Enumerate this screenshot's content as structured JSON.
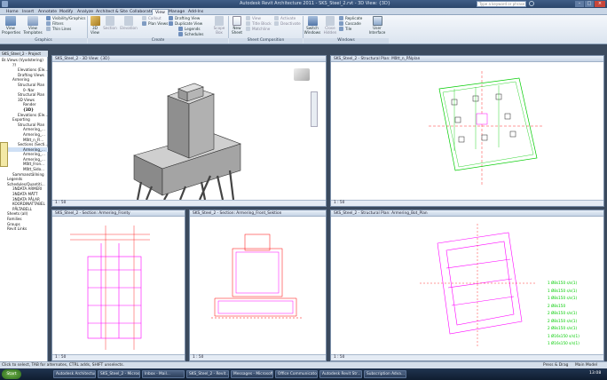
{
  "window": {
    "title": "Autodesk Revit Architecture 2011 - SKS_Steel_2.rvt - 3D View: {3D}"
  },
  "ribbon_tabs": [
    "Home",
    "Insert",
    "Annotate",
    "Modify",
    "Analyze",
    "Architect & Site",
    "Collaborate",
    "View",
    "Manage",
    "Add-Ins"
  ],
  "active_tab": "View",
  "ribbon": {
    "graphics": {
      "label": "Graphics",
      "view_properties": "View Properties",
      "view_templates": "View Templates",
      "visibility_graphics": "Visibility/Graphics",
      "filters": "Filters",
      "thin_lines": "Thin Lines"
    },
    "create": {
      "label": "Create",
      "view_3d": "3D View",
      "section": "Section",
      "elevation": "Elevation",
      "callout": "Callout",
      "plan_views": "Plan Views",
      "drafting_view": "Drafting View",
      "duplicate_view": "Duplicate View",
      "legends": "Legends",
      "schedules": "Schedules",
      "scope_box": "Scope Box"
    },
    "sheet_composition": {
      "label": "Sheet Composition",
      "new_sheet": "New Sheet",
      "view": "View",
      "title_block": "Title Block",
      "matchline": "Matchline",
      "activate": "Activate",
      "deactivate": "Deactivate"
    },
    "windows": {
      "label": "Windows",
      "switch_windows": "Switch Windows",
      "close_hidden": "Close Hidden",
      "replicate": "Replicate",
      "cascade": "Cascade",
      "tile": "Tile",
      "user_interface": "User Interface"
    }
  },
  "search": {
    "placeholder": "Type a keyword or phrase"
  },
  "browser": {
    "title": "SKS_Steel_2 - Project Br...",
    "items": [
      "Views (Vyodstering)",
      "??",
      "Elevations (Ele...",
      "Drafting Views",
      "Armering",
      "Structural Plan",
      "0- Nar",
      "Structural Plan",
      "3D Views",
      "Render",
      "{3D}",
      "Elevations (Ele...",
      "Exporting",
      "Structural Plan",
      "Armering_...",
      "Armering_...",
      "Mått_n_Fl...",
      "Sections (Secti...",
      "Armering_...",
      "Armering_...",
      "Armering_...",
      "Mått_Fron...",
      "Mått_Sido...",
      "Sammanställning",
      "Legends",
      "Schedules/Quantiti...",
      "3NDATA ARMERI",
      "3NDATA MÄTT",
      "3NDATA PÅLAR",
      "KOORDINATTABEL",
      "PÅLTABELL",
      "Sheets (all)",
      "Families",
      "Groups",
      "Revit Links"
    ]
  },
  "views": [
    {
      "title": "SKS_Steel_2 - 3D View: {3D}",
      "scale": "1 : 50"
    },
    {
      "title": "SKS_Steel_2 - Structural Plan: Mått_n_Pålplan",
      "scale": "1 : 50"
    },
    {
      "title": "SKS_Steel_2 - Section: Armering_Fronty",
      "scale": "1 : 50"
    },
    {
      "title": "SKS_Steel_2 - Section: Armering_Front_Sektion",
      "scale": "1 : 50"
    },
    {
      "title": "SKS_Steel_2 - Structural Plan: Armering_Bot_Plan",
      "scale": "1 : 50"
    }
  ],
  "rebar_notes": [
    "1 Ø8s150 s/s(1)",
    "1 Ø8s150 s/s(1)",
    "1 Ø8s150 s/s(1)",
    "2 Ø8s150",
    "2 Ø8s150 s/s(1)",
    "2 Ø8s150 s/s(1)",
    "2 Ø8s150 s/s(1)",
    "1 Ø16s150 s/s(1)",
    "1 Ø16s150 s/s(1)"
  ],
  "status": {
    "text": "Click to select, TAB for alternates, CTRL adds, SHIFT unselects.",
    "press_drag": "Press & Drag",
    "model": "Main Model"
  },
  "taskbar": {
    "start": "Start",
    "items": [
      "Autodesk Architecture...",
      "SKS_Steel_2 - Microsoft...",
      "Inbox - Mail...",
      "SKS_Steel_2 - Revit...",
      "Messages - Microsoft...",
      "Office Communicator",
      "Autodesk Revit Str...",
      "Subscription Adva..."
    ],
    "clock": "13:08"
  },
  "colors": {
    "rebar": "#ff00ff",
    "dim": "#ff0000",
    "pile": "#00cc00"
  }
}
